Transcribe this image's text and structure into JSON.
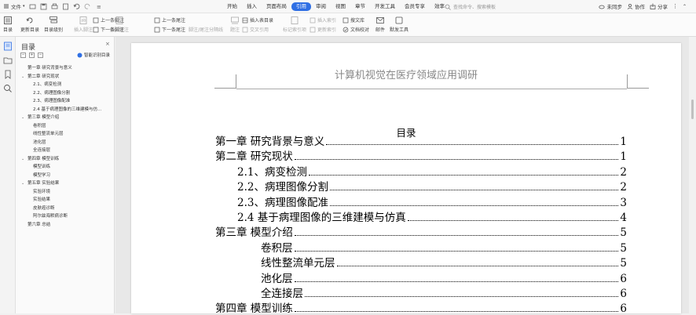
{
  "topbar": {
    "file_label": "文件",
    "menus": [
      "开始",
      "插入",
      "页面布局",
      "引用",
      "审阅",
      "视图",
      "章节",
      "开发工具",
      "会员专享",
      "效率"
    ],
    "active_menu": "引用",
    "search_placeholder": "查找命令、搜索模板",
    "right": {
      "sync": "未同步",
      "collab": "协作",
      "share": "分享"
    }
  },
  "ribbon": {
    "catalog": "目录",
    "update_catalog": "更新目录",
    "catalog_level": "目录级别",
    "insert_footnote": "插入脚注",
    "insert_endnote": "插入尾注",
    "prev_footnote": "上一条脚注",
    "next_footnote": "下一条脚注",
    "prev_endnote": "上一条尾注",
    "next_endnote": "下一条尾注",
    "footnote_sep": "脚注/尾注分隔线",
    "caption": "题注",
    "insert_table_of_figures": "插入表目录",
    "cross_ref": "交叉引用",
    "mark_index": "标记索引项",
    "insert_index": "插入索引",
    "update_index": "更新索引",
    "search_paper": "搜文库",
    "doc_check": "文档校对",
    "mail": "邮件",
    "tools": "默发工具"
  },
  "panel": {
    "title": "目录",
    "smart_label": "智能识别目录",
    "items": [
      {
        "label": "第一章  研究背景与意义",
        "level": 1,
        "caret": false
      },
      {
        "label": "第二章  研究现状",
        "level": 1,
        "caret": true
      },
      {
        "label": "2.1、病变检测",
        "level": 2,
        "caret": false
      },
      {
        "label": "2.2、病理图像分割",
        "level": 2,
        "caret": false
      },
      {
        "label": "2.3、病理图像配准",
        "level": 2,
        "caret": false
      },
      {
        "label": "2.4  基于病理图像的三维建模与仿…",
        "level": 2,
        "caret": false
      },
      {
        "label": "第三章  模型介绍",
        "level": 1,
        "caret": true
      },
      {
        "label": "卷积层",
        "level": 2,
        "caret": false
      },
      {
        "label": "线性整流单元层",
        "level": 2,
        "caret": false
      },
      {
        "label": "池化层",
        "level": 2,
        "caret": false
      },
      {
        "label": "全连接层",
        "level": 2,
        "caret": false
      },
      {
        "label": "第四章  模型训练",
        "level": 1,
        "caret": true
      },
      {
        "label": "模型训练",
        "level": 2,
        "caret": false
      },
      {
        "label": "模型学习",
        "level": 2,
        "caret": false
      },
      {
        "label": "第五章  实验结果",
        "level": 1,
        "caret": true
      },
      {
        "label": "实验环境",
        "level": 2,
        "caret": false
      },
      {
        "label": "实验结果",
        "level": 2,
        "caret": false
      },
      {
        "label": "皮肤癌诊断",
        "level": 2,
        "caret": false
      },
      {
        "label": "阿尔兹海默病诊断",
        "level": 2,
        "caret": false
      },
      {
        "label": "第六章  总结",
        "level": 1,
        "caret": false
      }
    ]
  },
  "document": {
    "header_text": "计算机视觉在医疗领域应用调研",
    "toc_heading": "目录",
    "toc_lines": [
      {
        "label": "第一章  研究背景与意义",
        "page": "1",
        "indent": 0
      },
      {
        "label": "第二章  研究现状",
        "page": "1",
        "indent": 0
      },
      {
        "label": "2.1、病变检测",
        "page": "2",
        "indent": 1
      },
      {
        "label": "2.2、病理图像分割",
        "page": "2",
        "indent": 1
      },
      {
        "label": "2.3、病理图像配准",
        "page": "3",
        "indent": 1
      },
      {
        "label": "2.4  基于病理图像的三维建模与仿真",
        "page": "4",
        "indent": 1
      },
      {
        "label": "第三章  模型介绍",
        "page": "5",
        "indent": 0
      },
      {
        "label": "卷积层",
        "page": "5",
        "indent": 2
      },
      {
        "label": "线性整流单元层",
        "page": "5",
        "indent": 2
      },
      {
        "label": "池化层",
        "page": "6",
        "indent": 2
      },
      {
        "label": "全连接层",
        "page": "6",
        "indent": 2
      },
      {
        "label": "第四章    模型训练",
        "page": "6",
        "indent": 0
      }
    ]
  },
  "colors": {
    "accent": "#2f6fe4"
  }
}
